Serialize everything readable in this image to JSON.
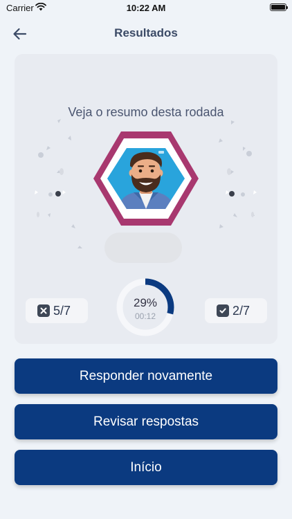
{
  "status_bar": {
    "carrier": "Carrier",
    "time": "10:22 AM"
  },
  "nav": {
    "title": "Resultados",
    "back_icon": "arrow-left-icon"
  },
  "summary": {
    "title": "Veja o resumo desta rodada",
    "wrong_count": "5/7",
    "right_count": "2/7",
    "percent_text": "29%",
    "percent_value": 0.29,
    "elapsed": "00:12"
  },
  "colors": {
    "primary": "#0b3a80",
    "badge_frame": "#a8386f",
    "avatar_bg": "#29a4dc",
    "card_bg": "#e8ebf1",
    "page_bg": "#eff3f8"
  },
  "buttons": {
    "retry": "Responder novamente",
    "review": "Revisar respostas",
    "home": "Início"
  }
}
